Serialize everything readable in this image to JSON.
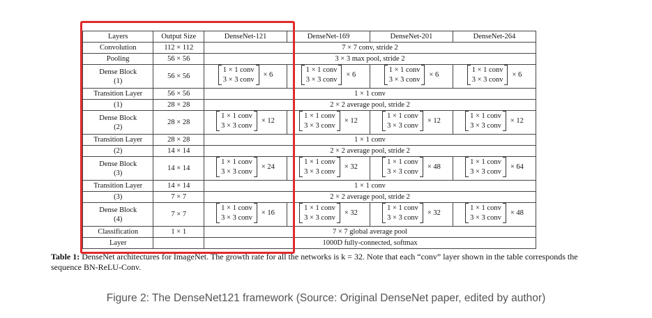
{
  "table": {
    "headers": [
      "Layers",
      "Output Size",
      "DenseNet-121",
      "DenseNet-169",
      "DenseNet-201",
      "DenseNet-264"
    ],
    "rows": [
      {
        "layer": "Convolution",
        "output": "112 × 112",
        "span": "7 × 7 conv, stride 2"
      },
      {
        "layer": "Pooling",
        "output": "56 × 56",
        "span": "3 × 3 max pool, stride 2"
      },
      {
        "layer": "Dense Block (1)",
        "output": "56 × 56",
        "block": {
          "line1": "1 × 1 conv",
          "line2": "3 × 3 conv",
          "mult": [
            "× 6",
            "× 6",
            "× 6",
            "× 6"
          ]
        }
      },
      {
        "layer": "Transition Layer (1)",
        "layer_line1": "Transition Layer",
        "output": "56 × 56",
        "span": "1 × 1 conv"
      },
      {
        "layer_line2": "(1)",
        "output": "28 × 28",
        "span": "2 × 2 average pool, stride 2"
      },
      {
        "layer": "Dense Block (2)",
        "output": "28 × 28",
        "block": {
          "line1": "1 × 1 conv",
          "line2": "3 × 3 conv",
          "mult": [
            "× 12",
            "× 12",
            "× 12",
            "× 12"
          ]
        }
      },
      {
        "layer_line1": "Transition Layer",
        "output": "28 × 28",
        "span": "1 × 1 conv"
      },
      {
        "layer_line2": "(2)",
        "output": "14 × 14",
        "span": "2 × 2 average pool, stride 2"
      },
      {
        "layer": "Dense Block (3)",
        "output": "14 × 14",
        "block": {
          "line1": "1 × 1 conv",
          "line2": "3 × 3 conv",
          "mult": [
            "× 24",
            "× 32",
            "× 48",
            "× 64"
          ]
        }
      },
      {
        "layer_line1": "Transition Layer",
        "output": "14 × 14",
        "span": "1 × 1 conv"
      },
      {
        "layer_line2": "(3)",
        "output": "7 × 7",
        "span": "2 × 2 average pool, stride 2"
      },
      {
        "layer": "Dense Block (4)",
        "output": "7 × 7",
        "block": {
          "line1": "1 × 1 conv",
          "line2": "3 × 3 conv",
          "mult": [
            "× 16",
            "× 32",
            "× 32",
            "× 48"
          ]
        }
      },
      {
        "layer_line1": "Classification",
        "output": "1 × 1",
        "span": "7 × 7 global average pool"
      },
      {
        "layer_line2": "Layer",
        "output": "",
        "span": "1000D fully-connected, softmax"
      }
    ]
  },
  "caption": {
    "label": "Table 1:",
    "text": " DenseNet architectures for ImageNet. The growth rate for all the networks is k = 32. Note that each “conv” layer shown in the table corresponds the sequence BN-ReLU-Conv."
  },
  "figure_caption": "Figure 2: The DenseNet121 framework (Source: Original DenseNet paper, edited by author)",
  "highlight_color": "#e02a2a"
}
